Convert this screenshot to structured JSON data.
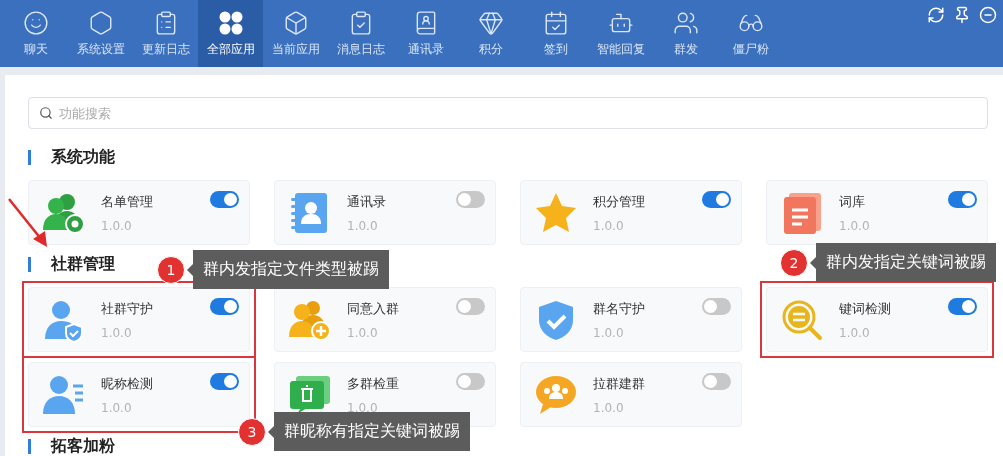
{
  "nav": [
    {
      "label": "聊天",
      "selected": false
    },
    {
      "label": "系统设置",
      "selected": false
    },
    {
      "label": "更新日志",
      "selected": false
    },
    {
      "label": "全部应用",
      "selected": true
    },
    {
      "label": "当前应用",
      "selected": false
    },
    {
      "label": "消息日志",
      "selected": false
    },
    {
      "label": "通讯录",
      "selected": false
    },
    {
      "label": "积分",
      "selected": false
    },
    {
      "label": "签到",
      "selected": false
    },
    {
      "label": "智能回复",
      "selected": false
    },
    {
      "label": "群发",
      "selected": false
    },
    {
      "label": "僵尸粉",
      "selected": false
    }
  ],
  "search": {
    "placeholder": "功能搜索"
  },
  "sections": [
    {
      "title": "系统功能",
      "apps": [
        {
          "name": "名单管理",
          "version": "1.0.0",
          "on": true,
          "highlighted": false
        },
        {
          "name": "通讯录",
          "version": "1.0.0",
          "on": false,
          "highlighted": false
        },
        {
          "name": "积分管理",
          "version": "1.0.0",
          "on": true,
          "highlighted": false
        },
        {
          "name": "词库",
          "version": "1.0.0",
          "on": true,
          "highlighted": false
        }
      ]
    },
    {
      "title": "社群管理",
      "apps": [
        {
          "name": "社群守护",
          "version": "1.0.0",
          "on": true,
          "highlighted": true
        },
        {
          "name": "同意入群",
          "version": "1.0.0",
          "on": false,
          "highlighted": false
        },
        {
          "name": "群名守护",
          "version": "1.0.0",
          "on": false,
          "highlighted": false
        },
        {
          "name": "键词检测",
          "version": "1.0.0",
          "on": true,
          "highlighted": true
        },
        {
          "name": "昵称检测",
          "version": "1.0.0",
          "on": true,
          "highlighted": true
        },
        {
          "name": "多群检重",
          "version": "1.0.0",
          "on": false,
          "highlighted": false
        },
        {
          "name": "拉群建群",
          "version": "1.0.0",
          "on": false,
          "highlighted": false
        }
      ]
    },
    {
      "title": "拓客加粉"
    }
  ],
  "callouts": [
    {
      "number": "1",
      "text": "群内发指定文件类型被踢"
    },
    {
      "number": "2",
      "text": "群内发指定关键词被踢"
    },
    {
      "number": "3",
      "text": "群昵称有指定关键词被踢"
    }
  ]
}
